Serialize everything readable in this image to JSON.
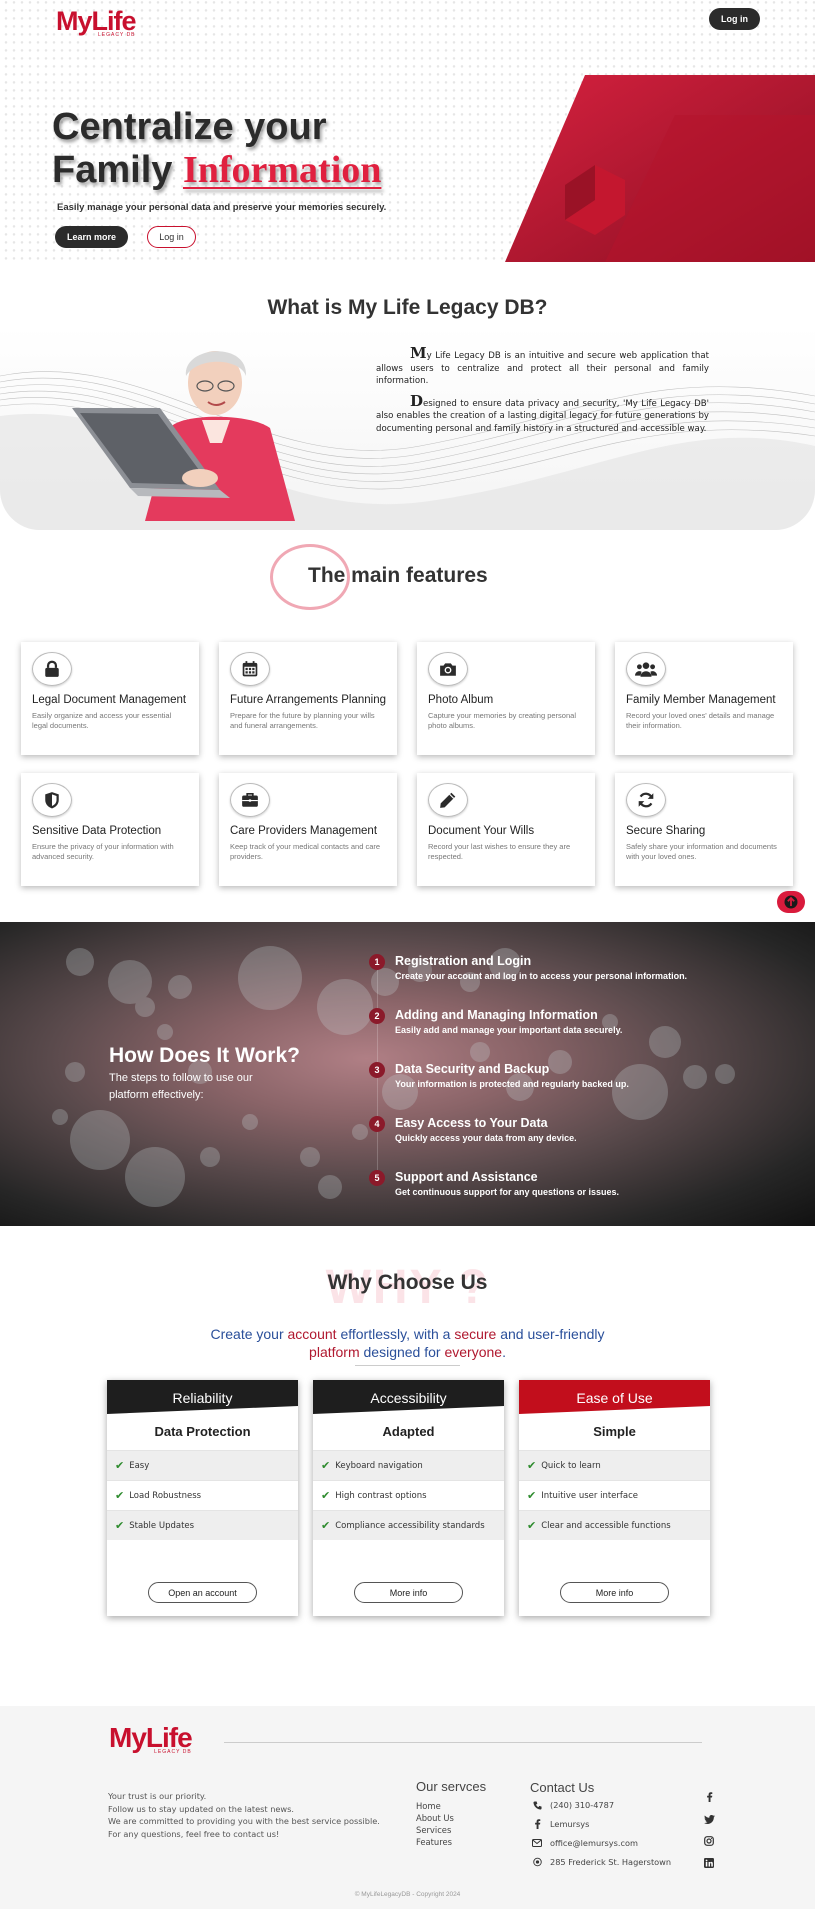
{
  "brand": {
    "name": "MyLife",
    "tagline": "LEGACY DB",
    "accent": "#c8102e"
  },
  "header": {
    "login_label": "Log in"
  },
  "hero": {
    "title_line1": "Centralize your",
    "title_line2_plain": "Family",
    "title_line2_accent": "Information",
    "subtitle": "Easily manage your personal data and preserve your memories securely.",
    "learn_more_label": "Learn more",
    "login_label": "Log in"
  },
  "what": {
    "title": "What is My Life Legacy DB?",
    "p1_first": "M",
    "p1_rest": "y Life Legacy DB is an intuitive and secure web application that allows users to centralize and protect all their personal and family information.",
    "p2_first": "D",
    "p2_rest": "esigned to ensure data privacy and security, 'My Life Legacy DB' also enables the creation of a lasting digital legacy for future generations by documenting personal and family history in a structured and accessible way."
  },
  "features": {
    "title": "The main features",
    "items": [
      {
        "icon": "lock-icon",
        "title": "Legal Document Management",
        "desc": "Easily organize and access your essential legal documents."
      },
      {
        "icon": "calendar-icon",
        "title": "Future Arrangements Planning",
        "desc": "Prepare for the future by planning your wills and funeral arrangements."
      },
      {
        "icon": "camera-icon",
        "title": "Photo Album",
        "desc": "Capture your memories by creating personal photo albums."
      },
      {
        "icon": "users-icon",
        "title": "Family Member Management",
        "desc": "Record your loved ones' details and manage their information."
      },
      {
        "icon": "shield-icon",
        "title": "Sensitive Data Protection",
        "desc": "Ensure the privacy of your information with advanced security."
      },
      {
        "icon": "briefcase-icon",
        "title": "Care Providers Management",
        "desc": "Keep track of your medical contacts and care providers."
      },
      {
        "icon": "pen-icon",
        "title": "Document Your Wills",
        "desc": "Record your last wishes to ensure they are respected."
      },
      {
        "icon": "sync-icon",
        "title": "Secure Sharing",
        "desc": "Safely share your information and documents with your loved ones."
      }
    ]
  },
  "how": {
    "title": "How Does It Work?",
    "subtitle": "The steps to follow to use our platform effectively:",
    "steps": [
      {
        "num": "1",
        "title": "Registration and Login",
        "desc": "Create your account and log in to access your personal information."
      },
      {
        "num": "2",
        "title": "Adding and Managing Information",
        "desc": "Easily add and manage your important data securely."
      },
      {
        "num": "3",
        "title": "Data Security and Backup",
        "desc": "Your information is protected and regularly backed up."
      },
      {
        "num": "4",
        "title": "Easy Access to Your Data",
        "desc": "Quickly access your data from any device."
      },
      {
        "num": "5",
        "title": "Support and Assistance",
        "desc": "Get continuous support for any questions or issues."
      }
    ]
  },
  "why": {
    "bg_text": "WHY ?",
    "title": "Why Choose Us",
    "sub": {
      "a": "Create your ",
      "b": "account",
      "c": " effortlessly, with a ",
      "d": "secure",
      "e": " and ",
      "f": "user-friendly",
      "g": "platform",
      "h": " designed for ",
      "i": "everyone",
      "j": "."
    },
    "plans": [
      {
        "header": "Reliability",
        "subheader": "Data Protection",
        "rows": [
          "Easy",
          "Load Robustness",
          "Stable Updates"
        ],
        "button": "Open an account",
        "color": "#1e1e1e"
      },
      {
        "header": "Accessibility",
        "subheader": "Adapted",
        "rows": [
          "Keyboard navigation",
          "High contrast options",
          "Compliance accessibility standards"
        ],
        "button": "More info",
        "color": "#1e1e1e"
      },
      {
        "header": "Ease of Use",
        "subheader": "Simple",
        "rows": [
          "Quick to learn",
          "Intuitive user interface",
          "Clear and accessible functions"
        ],
        "button": "More info",
        "color": "#c20e1c"
      }
    ]
  },
  "footer": {
    "about": [
      "Your trust is our priority.",
      "Follow us to stay updated on the latest news.",
      "We are committed to providing you with the best service possible.",
      "For any questions, feel free to contact us!"
    ],
    "services_title": "Our servces",
    "services": [
      "Home",
      "About Us",
      "Services",
      "Features"
    ],
    "contact_title": "Contact Us",
    "phone": "(240) 310-4787",
    "facebook": "Lemursys",
    "email": "office@lemursys.com",
    "address": "285 Frederick St. Hagerstown",
    "social": [
      "facebook-icon",
      "twitter-icon",
      "instagram-icon",
      "linkedin-icon"
    ],
    "copyright": "© MyLifeLegacyDB - Copyright 2024"
  }
}
